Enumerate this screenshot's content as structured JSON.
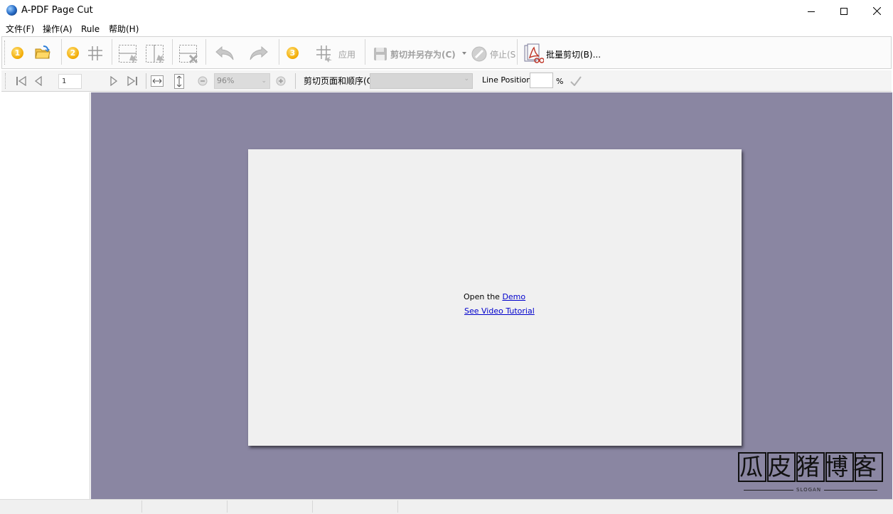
{
  "window": {
    "title": "A-PDF Page Cut",
    "minimize_icon": "minimize-icon",
    "maximize_icon": "maximize-icon",
    "close_icon": "close-icon"
  },
  "menu": {
    "items": [
      {
        "label": "文件(F)"
      },
      {
        "label": "操作(A)"
      },
      {
        "label": "Rule"
      },
      {
        "label": "帮助(H)"
      }
    ]
  },
  "toolbar": {
    "step1_badge": "1",
    "step2_badge": "2",
    "step3_badge": "3",
    "apply_label": "应用",
    "cut_save_as_label": "剪切并另存为(C)",
    "stop_label": "停止(S",
    "batch_cut_label": "批量剪切(B)...",
    "icons": [
      "open-folder-icon",
      "grid-icon",
      "add-vertical-cut-icon",
      "add-horizontal-cut-icon",
      "delete-cut-icon",
      "undo-icon",
      "redo-icon",
      "apply-grid-icon",
      "save-icon",
      "stop-icon",
      "batch-cut-icon"
    ]
  },
  "navbar": {
    "page_number": "1",
    "zoom_value": "96%",
    "cut_order_label": "剪切页面和顺序(O",
    "cut_order_value": "",
    "line_position_label": "Line Position:",
    "line_position_value": "",
    "percent_label": "%"
  },
  "viewer": {
    "open_prefix": "Open the",
    "demo_link": "Demo",
    "video_link": "See Video Tutorial"
  },
  "watermark": {
    "main_text": "瓜皮猪博客",
    "sub_text": "SLOGAN"
  },
  "colors": {
    "viewer_bg": "#8a86a2",
    "page_bg": "#f0f0f0",
    "link": "#0000cc",
    "badge": "#f2a900"
  }
}
